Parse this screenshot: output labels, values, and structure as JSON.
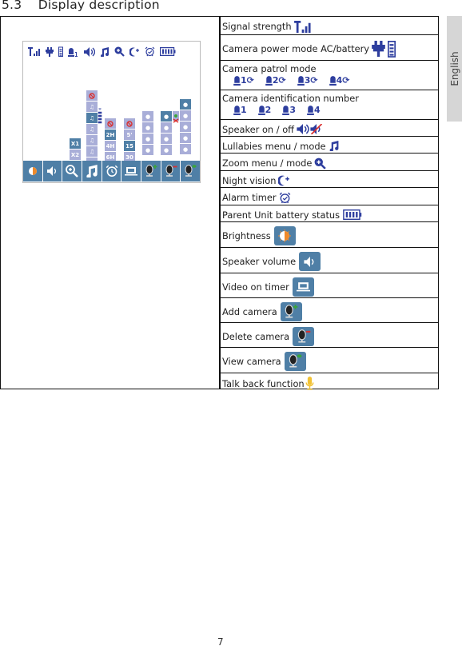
{
  "section": {
    "number": "5.3",
    "title": "Display description",
    "heading": "5.3    Display description"
  },
  "side_tab": {
    "label": "English"
  },
  "page_number": "7",
  "colors": {
    "icon_blue": "#2e3e9e",
    "tile_blue": "#4f7fa6",
    "menu_lilac": "#a9aed8",
    "brightness_orange": "#f08a2a",
    "add_green": "#3aa53a",
    "delete_red": "#d93030",
    "talkback_yellow": "#f2c234"
  },
  "screen": {
    "top_icons": [
      "signal-strength-icon",
      "power-plug-icon",
      "battery-icon",
      "camera-1-icon",
      "speaker-icon",
      "lullaby-icon",
      "zoom-icon",
      "night-vision-icon",
      "alarm-icon",
      "parent-battery-icon"
    ],
    "zoom_options": [
      "X1",
      "X2"
    ],
    "lullaby_tracks": [
      "1",
      "2",
      "3",
      "4",
      "5"
    ],
    "alarm_options": [
      "2H",
      "4H",
      "6H"
    ],
    "video_timer_options": [
      "5'",
      "15",
      "30"
    ],
    "camera_slots": [
      "1",
      "2",
      "3",
      "4"
    ],
    "bottom_bar": [
      "brightness",
      "speaker-volume",
      "zoom",
      "lullabies",
      "alarm-timer",
      "video-on-timer",
      "add-camera",
      "delete-camera",
      "view-camera"
    ]
  },
  "rows": [
    {
      "label": "Signal strength",
      "icon": "signal-strength-icon"
    },
    {
      "label": "Camera power mode AC/battery",
      "icon": "power-battery-icon"
    },
    {
      "label": "Camera patrol mode",
      "cameras": [
        "1",
        "2",
        "3",
        "4"
      ]
    },
    {
      "label": "Camera identification number",
      "cameras": [
        "1",
        "2",
        "3",
        "4"
      ]
    },
    {
      "label": "Speaker on / off",
      "icon": "speaker-on-off-icon"
    },
    {
      "label": "Lullabies menu / mode",
      "icon": "lullaby-icon"
    },
    {
      "label": "Zoom menu / mode",
      "icon": "zoom-icon"
    },
    {
      "label": "Night vision",
      "icon": "night-vision-icon"
    },
    {
      "label": "Alarm timer",
      "icon": "alarm-icon"
    },
    {
      "label": "Parent Unit battery status",
      "icon": "parent-battery-icon"
    },
    {
      "label": "Brightness",
      "icon": "brightness-icon"
    },
    {
      "label": "Speaker volume",
      "icon": "speaker-volume-icon"
    },
    {
      "label": "Video on  timer",
      "icon": "video-timer-icon"
    },
    {
      "label": "Add camera",
      "icon": "add-camera-icon"
    },
    {
      "label": "Delete camera",
      "icon": "delete-camera-icon"
    },
    {
      "label": "View camera",
      "icon": "view-camera-icon"
    },
    {
      "label": "Talk back function",
      "icon": "talk-back-icon"
    }
  ]
}
